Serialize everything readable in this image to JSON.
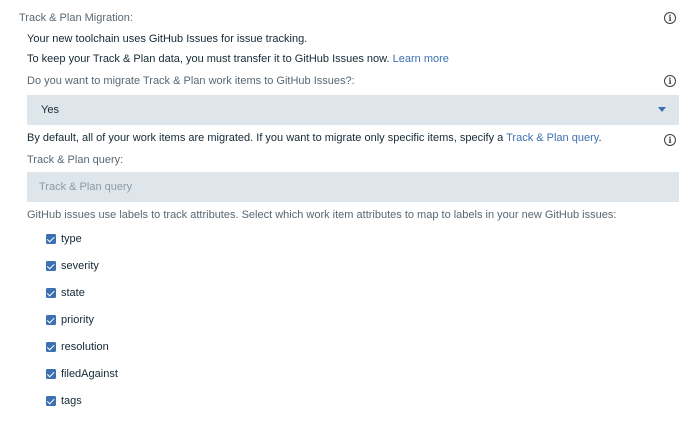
{
  "section_title": "Track & Plan Migration:",
  "intro_line1": "Your new toolchain uses GitHub Issues for issue tracking.",
  "intro_line2": "To keep your Track & Plan data, you must transfer it to GitHub Issues now.",
  "learn_more_link": "Learn more",
  "migrate_question": "Do you want to migrate Track & Plan work items to GitHub Issues?:",
  "migrate_select_value": "Yes",
  "default_text": "By default, all of your work items are migrated. If you want to migrate only specific items, specify a",
  "query_link": "Track & Plan query",
  "query_field_label": "Track & Plan query:",
  "query_placeholder": "Track & Plan query",
  "labels_text": "GitHub issues use labels to track attributes. Select which work item attributes to map to labels in your new GitHub issues:",
  "attributes": [
    {
      "label": "type",
      "checked": true
    },
    {
      "label": "severity",
      "checked": true
    },
    {
      "label": "state",
      "checked": true
    },
    {
      "label": "priority",
      "checked": true
    },
    {
      "label": "resolution",
      "checked": true
    },
    {
      "label": "filedAgainst",
      "checked": true
    },
    {
      "label": "tags",
      "checked": true
    }
  ],
  "colors": {
    "accent": "#3d70b2",
    "field_bg": "#dfe6eb",
    "text": "#152935",
    "muted": "#5a6872"
  },
  "icons": {
    "info": "info-circle-icon",
    "caret": "caret-down-icon",
    "checkbox": "checkbox-checked-icon"
  }
}
